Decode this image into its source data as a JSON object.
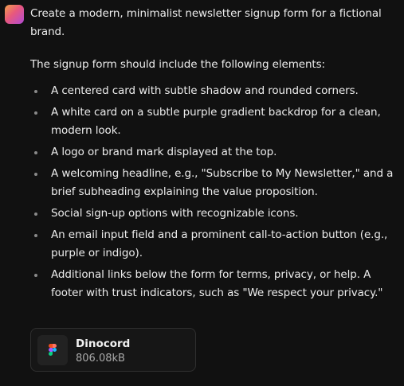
{
  "message": {
    "intro": "Create a modern, minimalist newsletter signup form for a fictional brand.",
    "lead": "The signup form should include the following elements:",
    "bullets": [
      "A centered card with subtle shadow and rounded corners.",
      "A white card on a subtle purple gradient backdrop for a clean, modern look.",
      "A logo or brand mark displayed at the top.",
      "A welcoming headline, e.g., \"Subscribe to My Newsletter,\" and a brief subheading explaining the value proposition.",
      "Social sign-up options with recognizable icons.",
      "An email input field and a prominent call-to-action button (e.g., purple or indigo).",
      "Additional links below the form for terms, privacy, or help. A footer with trust indicators, such as \"We respect your privacy.\""
    ]
  },
  "attachment": {
    "name": "Dinocord",
    "size": "806.08kB",
    "icon": "figma-icon"
  },
  "colors": {
    "background": "#111111",
    "text": "#ececec",
    "muted": "#a9a9a9"
  }
}
